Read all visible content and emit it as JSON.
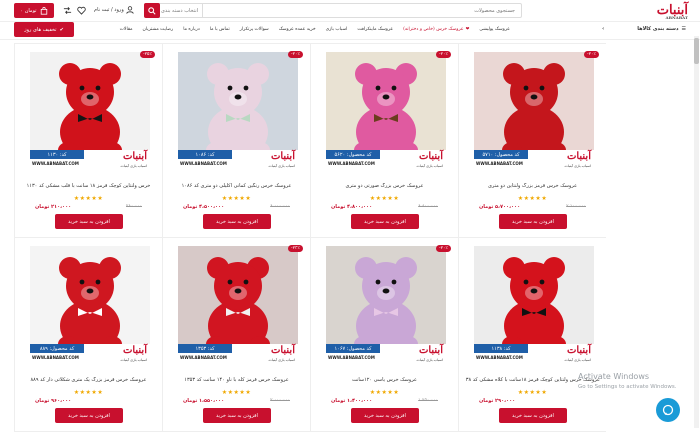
{
  "header": {
    "logo_text": "آبنبات",
    "logo_sub": "ABNABAT",
    "search_placeholder": "جستجوی محصولات",
    "search_category": "انتخاب دسته بندی",
    "login_label": "ورود / ثبت نام",
    "cart_label": "۰ تومان",
    "cart_count": "0",
    "wishlist_count": "0",
    "compare_count": "0"
  },
  "nav": {
    "categories_label": "دسته بندی کالاها",
    "links": [
      {
        "label": "عروسک پولیشی",
        "red": false
      },
      {
        "label": "عروسک خرس (خاص و دخترانه)",
        "red": true
      },
      {
        "label": "عروسک ماینکرافت",
        "red": false
      },
      {
        "label": "اسباب بازی",
        "red": false
      },
      {
        "label": "خرید عمده عروسک",
        "red": false
      },
      {
        "label": "سوالات پرتکرار",
        "red": false
      },
      {
        "label": "تماس با ما",
        "red": false
      },
      {
        "label": "درباره ما",
        "red": false
      },
      {
        "label": "رضایت مشتریان",
        "red": false
      },
      {
        "label": "مقالات",
        "red": false
      }
    ],
    "offers_label": "تخفیف های روز"
  },
  "products": [
    {
      "title": "عروسک خرس قرمز بزرگ ولنتاین دو متری",
      "discount": "-۲۰٪",
      "old_price": "۷،۱۰۰،۰۰۰",
      "price": "۵،۷۰۰،۰۰۰ تومان",
      "code": "کد محصول: ۵۷۱۰",
      "button": "افزودن به سبد خرید",
      "bg": "#ead7d4",
      "bear": "#c4161c",
      "bow": "#c4161c"
    },
    {
      "title": "عروسک خرس بزرگ صورتی دو متری",
      "discount": "-۲۰٪",
      "old_price": "۶،۸۰۰،۰۰۰",
      "price": "۴،۸۰۰،۰۰۰ تومان",
      "code": "کد محصول: ۵۶۲۰",
      "button": "افزودن به سبد خرید",
      "bg": "#e9e2d3",
      "bear": "#e05aa0",
      "bow": "#6b3d1e"
    },
    {
      "title": "عروسک خرس رنگین کمانی اکلیلی دو متری کد ۱۰۸۶",
      "discount": "-۲۰٪",
      "old_price": "۶،۰۰۰،۰۰۰",
      "price": "۴،۵۰۰،۰۰۰ تومان",
      "code": "کد: ۱۰۸۶",
      "button": "افزودن به سبد خرید",
      "bg": "#cfd6de",
      "bear": "#e9d3e0",
      "bow": "#b9d8c2"
    },
    {
      "title": "خرس ولنتاین کوچک قرمز ۱۸ سانت با قلب مشکی کد ۱۱۳۰",
      "discount": "-۲۵٪",
      "old_price": "۲۸۰،۰۰۰",
      "price": "۲۱۰،۰۰۰ تومان",
      "code": "کد: ۱۱۳۰",
      "button": "افزودن به سبد خرید",
      "bg": "#f2f2f2",
      "bear": "#d0121b",
      "bow": "#151515"
    },
    {
      "title": "عروسک خرس ولنتاین کوچک قرمز ۱۸سانت با کلاه مشکی کد ۱۱۳۸",
      "discount": "",
      "old_price": "",
      "price": "۲۹۰،۰۰۰ تومان",
      "code": "کد: ۱۱۳۸",
      "button": "افزودن به سبد خرید",
      "bg": "#ececec",
      "bear": "#d4121c",
      "bow": "#111111"
    },
    {
      "title": "عروسک خرس یاسی ۱۲۰سانت",
      "discount": "-۲۰٪",
      "old_price": "۱،۷۵۰،۰۰۰",
      "price": "۱،۴۰۰،۰۰۰ تومان",
      "code": "کد محصول: ۱۰۶۷",
      "button": "افزودن به سبد خرید",
      "bg": "#d9d4cf",
      "bear": "#c9a7d6",
      "bow": "#e7c7e5"
    },
    {
      "title": "عروسک خرس قرمز کله با ناو ۱۴۰ سانت کد ۱۳۵۳",
      "discount": "-۲۳٪",
      "old_price": "۲،۰۰۰،۰۰۰",
      "price": "۱،۵۵۰،۰۰۰ تومان",
      "code": "کد: ۱۳۵۳",
      "button": "افزودن به سبد خرید",
      "bg": "#d7c9c8",
      "bear": "#d11521",
      "bow": "#f1f1f1"
    },
    {
      "title": "عروسک خرس قرمز بزرگ یک متری شکلاتی دار کد ۸۸۹",
      "discount": "",
      "old_price": "",
      "price": "۹۶۰،۰۰۰ تومان",
      "code": "کد محصول: ۸۸۹",
      "button": "افزودن به سبد خرید",
      "bg": "#f4f4f4",
      "bear": "#cf1720",
      "bow": "#ffffff"
    }
  ],
  "site_url": "WWW.ABNABAT.COM",
  "image_subtitle": "اسباب بازی آبنبات",
  "watermark": {
    "title": "Activate Windows",
    "sub": "Go to Settings to activate Windows."
  }
}
